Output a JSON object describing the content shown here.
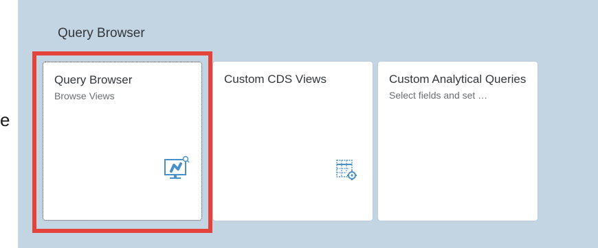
{
  "stray_text": "e",
  "group": {
    "title": "Query Browser"
  },
  "tiles": [
    {
      "title": "Query Browser",
      "subtitle": "Browse Views",
      "icon": "query-monitor-icon"
    },
    {
      "title": "Custom CDS Views",
      "subtitle": "",
      "icon": "table-settings-icon"
    },
    {
      "title": "Custom Analytical Queries",
      "subtitle": "Select fields and set …",
      "icon": ""
    }
  ],
  "colors": {
    "panel_bg": "#c3d4e3",
    "tile_bg": "#ffffff",
    "icon_blue": "#4a90c8",
    "highlight": "#e4433c"
  }
}
